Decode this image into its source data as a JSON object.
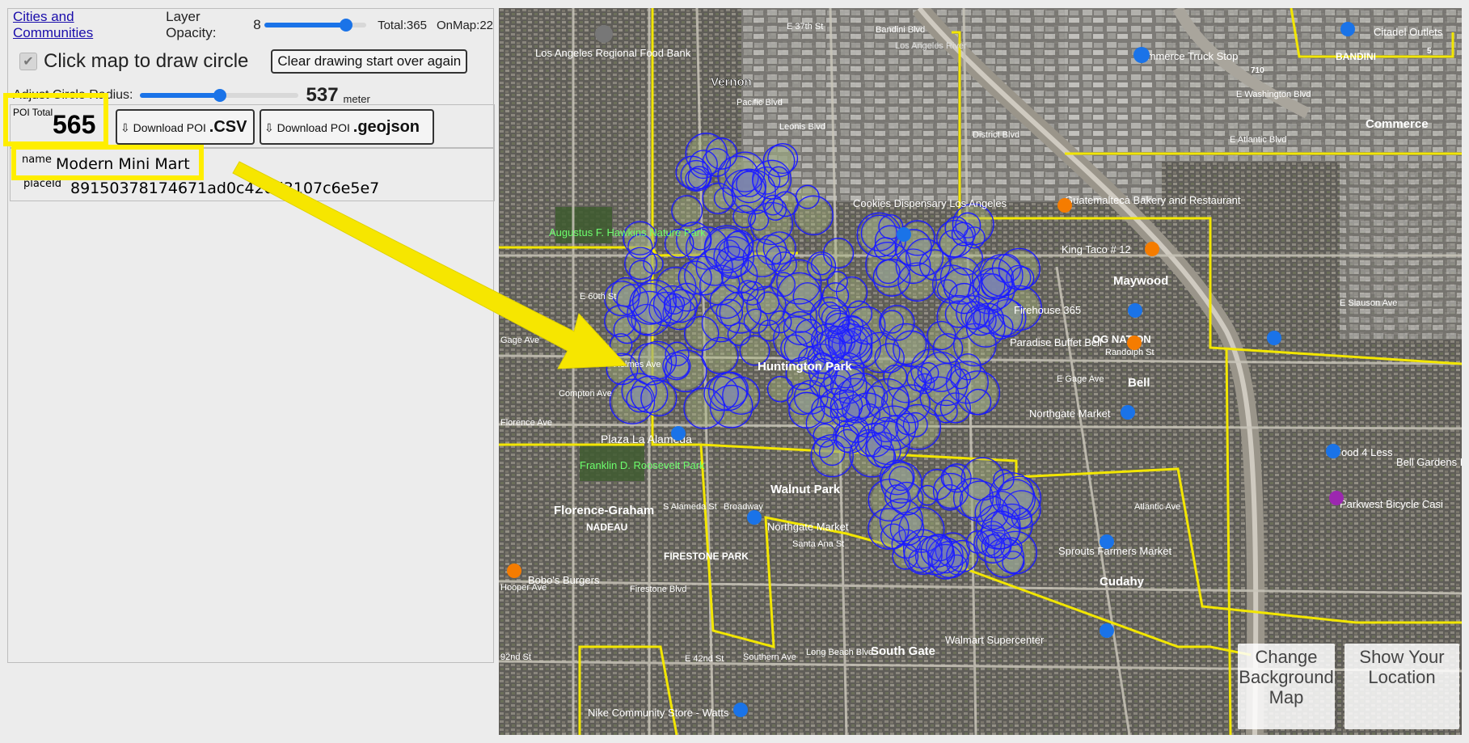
{
  "controls": {
    "layer_link": "Cities and Communities",
    "opacity_label": "Layer Opacity:",
    "opacity_value": "8",
    "opacity_fraction": 0.8,
    "total_label": "Total:",
    "total_value": "365",
    "onmap_label": "OnMap:",
    "onmap_value": "22",
    "draw_label": "Click map to draw circle",
    "draw_checked": true,
    "clear_button": "Clear drawing start over again",
    "radius_label": "Adjust Circle Radius:",
    "radius_value": "537",
    "radius_unit": "meter",
    "radius_fraction": 0.51
  },
  "poi": {
    "total_label": "POI Total",
    "total_value": "565",
    "download_prefix": "⇩ Download POI",
    "csv_ext": ".CSV",
    "geojson_ext": ".geojson"
  },
  "selected": {
    "name_key": "name",
    "name_value": "Modern Mini Mart",
    "placeid_key": "placeId",
    "placeid_value": "89150378174671ad0c42dd3107c6e5e7"
  },
  "map": {
    "labels": {
      "vernon": "Vernon",
      "bandini": "BANDINI",
      "commerce": "Commerce",
      "citadel": "Citadel Outlets",
      "commerce_truck": "Commerce Truck Stop",
      "la_food_bank": "Los Angeles Regional Food Bank",
      "augustus": "Augustus F. Hawkins Nature Park",
      "cookies": "Cookies Dispensary Los Angeles",
      "guatemalteca": "Guatemalteca Bakery and Restaurant",
      "king_taco": "King Taco # 12",
      "maywood": "Maywood",
      "firehouse": "Firehouse 365",
      "paradise": "Paradise Buffet Bell",
      "og_nation": "OG NATION",
      "bell": "Bell",
      "northgate_bell": "Northgate Market",
      "food4less": "Food 4 Less",
      "bell_gardens": "Bell Gardens D",
      "parkwest": "Parkwest Bicycle Casi",
      "huntington": "Huntington Park",
      "plaza": "Plaza La Alameda",
      "franklin": "Franklin D. Roosevelt Park",
      "walnut_park": "Walnut Park",
      "florence_graham": "Florence-Graham",
      "nadeau": "NADEAU",
      "firestone_park": "FIRESTONE PARK",
      "northgate_wp": "Northgate Market",
      "sprouts": "Sprouts Farmers Market",
      "cudahy": "Cudahy",
      "bobos": "Bobo's Burgers",
      "walmart": "Walmart Supercenter",
      "south_gate": "South Gate",
      "nike": "Nike Community Store - Watts",
      "gage_ave": "Gage Ave",
      "florence_ave": "Florence Ave",
      "e_60th": "E 60th St",
      "slauson": "E Slauson Ave",
      "e_gage": "E Gage Ave",
      "firestone_blvd": "Firestone Blvd",
      "randolph": "Randolph St",
      "e_37th": "E 37th St",
      "bandini_blvd": "Bandini Blvd",
      "la_river": "Los Angeles River",
      "washington": "E Washington Blvd",
      "district": "District Blvd",
      "leonis": "Leonis Blvd",
      "atlantic_blvd": "E Atlantic Blvd",
      "s_alameda": "S Alameda St",
      "southern": "Southern Ave",
      "long_beach": "Long Beach Blvd",
      "compton": "Compton Ave",
      "hooper": "Hooper Ave",
      "holmes": "Holmes Ave",
      "broadway": "Broadway",
      "santa_ana": "Santa Ana St",
      "pacific": "Pacific Blvd",
      "92nd": "92nd St",
      "e_42nd": "E 42nd St",
      "atlantic_ave": "Atlantic Ave",
      "i710": "710",
      "i5": "5"
    },
    "change_bg": "Change Background Map",
    "show_location": "Show Your Location"
  },
  "colors": {
    "accent": "#1a73e8",
    "highlight": "#ffee00",
    "circles": "#1a1aff",
    "boundary": "#f2e600",
    "link": "#1a0dab"
  }
}
